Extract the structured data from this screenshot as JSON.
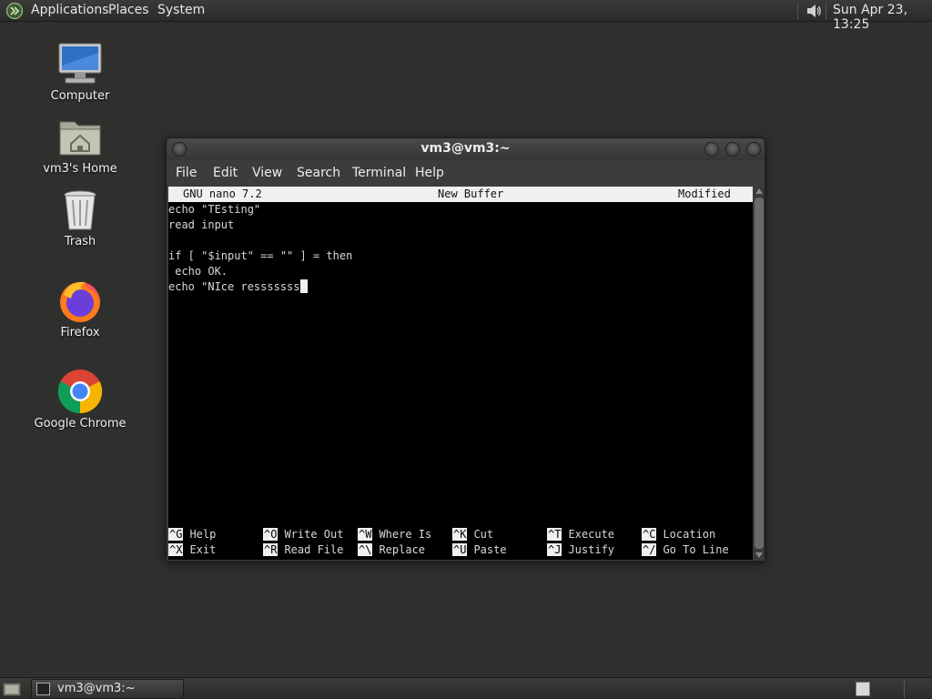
{
  "top_panel": {
    "menus": [
      "Applications",
      "Places",
      "System"
    ],
    "clock": "Sun Apr 23, 13:25"
  },
  "desktop_icons": [
    {
      "label": "Computer",
      "icon": "computer-icon"
    },
    {
      "label": "vm3's Home",
      "icon": "home-folder-icon"
    },
    {
      "label": "Trash",
      "icon": "trash-icon"
    },
    {
      "label": "Firefox",
      "icon": "firefox-icon"
    },
    {
      "label": "Google Chrome",
      "icon": "chrome-icon"
    }
  ],
  "window": {
    "title": "vm3@vm3:~",
    "menus": [
      "File",
      "Edit",
      "View",
      "Search",
      "Terminal",
      "Help"
    ]
  },
  "nano": {
    "header_left": "GNU nano 7.2",
    "header_center": "New Buffer",
    "header_right": "Modified",
    "lines": [
      "echo \"TEsting\"",
      "read input",
      "",
      "if [ \"$input\" == \"\" ] = then",
      " echo OK.",
      "echo \"NIce resssssss"
    ],
    "shortcuts": [
      {
        "key": "^G",
        "label": "Help"
      },
      {
        "key": "^O",
        "label": "Write Out"
      },
      {
        "key": "^W",
        "label": "Where Is"
      },
      {
        "key": "^K",
        "label": "Cut"
      },
      {
        "key": "^T",
        "label": "Execute"
      },
      {
        "key": "^C",
        "label": "Location"
      },
      {
        "key": "^X",
        "label": "Exit"
      },
      {
        "key": "^R",
        "label": "Read File"
      },
      {
        "key": "^\\",
        "label": "Replace"
      },
      {
        "key": "^U",
        "label": "Paste"
      },
      {
        "key": "^J",
        "label": "Justify"
      },
      {
        "key": "^/",
        "label": "Go To Line"
      }
    ]
  },
  "taskbar": {
    "task_label": "vm3@vm3:~"
  },
  "colors": {
    "desktop_bg": "#2f302d",
    "panel_bg": "#2b2b29",
    "terminal_bg": "#000000",
    "nano_header_bg": "#f0f0f0"
  }
}
